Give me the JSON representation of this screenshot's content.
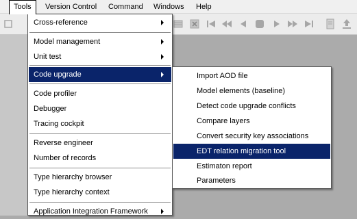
{
  "menubar": {
    "items": [
      "Tools",
      "Version Control",
      "Command",
      "Windows",
      "Help"
    ]
  },
  "toolbar": {
    "icons": [
      "grid-icon",
      "cancel-box-icon",
      "first-record-icon",
      "page-back-icon",
      "previous-record-icon",
      "stop-icon",
      "next-record-icon",
      "page-forward-icon",
      "last-record-icon",
      "document-icon",
      "upload-icon"
    ]
  },
  "tools_menu": {
    "items": [
      "Cross-reference",
      "Model management",
      "Unit test",
      "Code upgrade",
      "Code profiler",
      "Debugger",
      "Tracing cockpit",
      "Reverse engineer",
      "Number of records",
      "Type hierarchy browser",
      "Type hierarchy context",
      "Application Integration Framework"
    ]
  },
  "code_upgrade_menu": {
    "items": [
      "Import AOD file",
      "Model elements (baseline)",
      "Detect code upgrade conflicts",
      "Compare layers",
      "Convert security key associations",
      "EDT relation migration tool",
      "Estimaton report",
      "Parameters"
    ]
  },
  "colors": {
    "highlight": "#0a246a",
    "menu_background": "#ffffff",
    "workspace": "#ababab",
    "toolbar_icon": "#a6a6a6"
  }
}
